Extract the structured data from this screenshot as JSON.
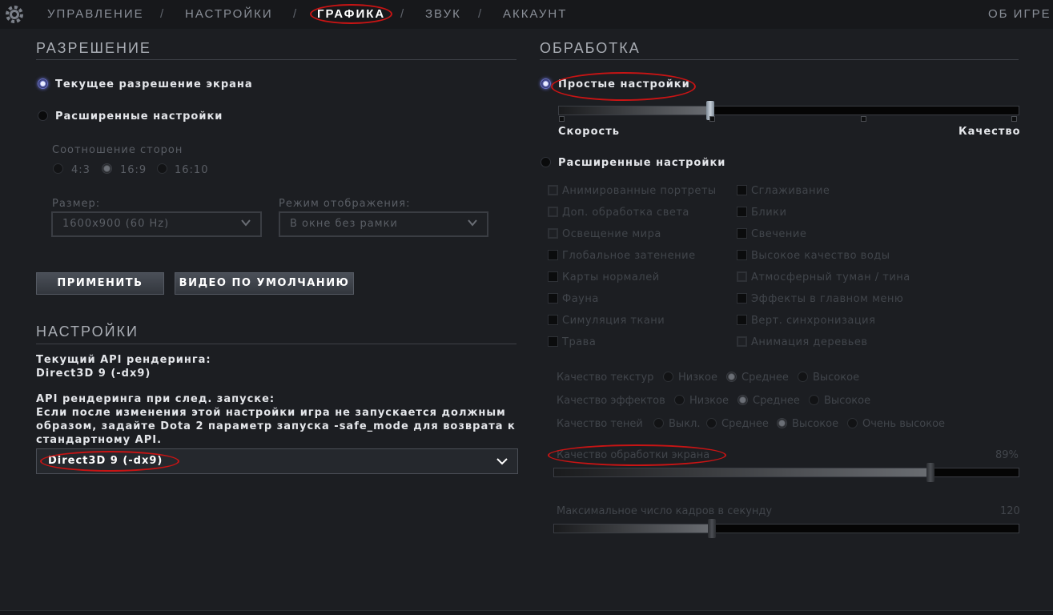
{
  "nav": {
    "items": [
      "УПРАВЛЕНИЕ",
      "НАСТРОЙКИ",
      "ГРАФИКА",
      "ЗВУК",
      "АККАУНТ"
    ],
    "separator": "/",
    "about": "ОБ ИГРЕ",
    "active": "ГРАФИКА"
  },
  "resolution": {
    "title": "РАЗРЕШЕНИЕ",
    "current_label": "Текущее разрешение экрана",
    "advanced_label": "Расширенные настройки",
    "aspect_title": "Соотношение сторон",
    "aspect_options": [
      "4:3",
      "16:9",
      "16:10"
    ],
    "aspect_selected": "16:9",
    "size_label": "Размер:",
    "size_value": "1600x900 (60 Hz)",
    "mode_label": "Режим отображения:",
    "mode_value": "В окне без рамки",
    "apply_button": "ПРИМЕНИТЬ",
    "default_button": "ВИДЕО ПО УМОЛЧАНИЮ"
  },
  "settings": {
    "title": "НАСТРОЙКИ",
    "current_api_label": "Текущий API рендеринга:",
    "current_api_value": "Direct3D 9 (-dx9)",
    "next_api_label": "API рендеринга при след. запуске:",
    "note_line1": "Если после изменения этой настройки игра не запускается должным",
    "note_line2": "образом, задайте Dota 2 параметр запуска -safe_mode для возврата к",
    "note_line3": "стандартному API.",
    "api_select_value": "Direct3D 9 (-dx9)"
  },
  "processing": {
    "title": "ОБРАБОТКА",
    "simple_label": "Простые настройки",
    "speed_label": "Скорость",
    "quality_label": "Качество",
    "quality_slider_fraction": 0.33,
    "advanced_label": "Расширенные настройки",
    "checks_left": [
      "Анимированные портреты",
      "Доп. обработка света",
      "Освещение мира",
      "Глобальное затенение",
      "Карты нормалей",
      "Фауна",
      "Симуляция ткани",
      "Трава"
    ],
    "checks_right": [
      "Сглаживание",
      "Блики",
      "Свечение",
      "Высокое качество воды",
      "Атмосферный туман / тина",
      "Эффекты в главном меню",
      "Верт. синхронизация",
      "Анимация деревьев"
    ],
    "texture_label": "Качество текстур",
    "texture_options": [
      "Низкое",
      "Среднее",
      "Высокое"
    ],
    "texture_selected": "Среднее",
    "effects_label": "Качество эффектов",
    "effects_options": [
      "Низкое",
      "Среднее",
      "Высокое"
    ],
    "effects_selected": "Среднее",
    "shadows_label": "Качество теней",
    "shadows_options": [
      "Выкл.",
      "Среднее",
      "Высокое",
      "Очень высокое"
    ],
    "shadows_selected": "Высокое",
    "screen_quality_label": "Качество обработки экрана",
    "screen_quality_value": "89%",
    "screen_quality_fraction": 0.81,
    "fps_label": "Максимальное число кадров в секунду",
    "fps_value": "120",
    "fps_fraction": 0.34
  }
}
